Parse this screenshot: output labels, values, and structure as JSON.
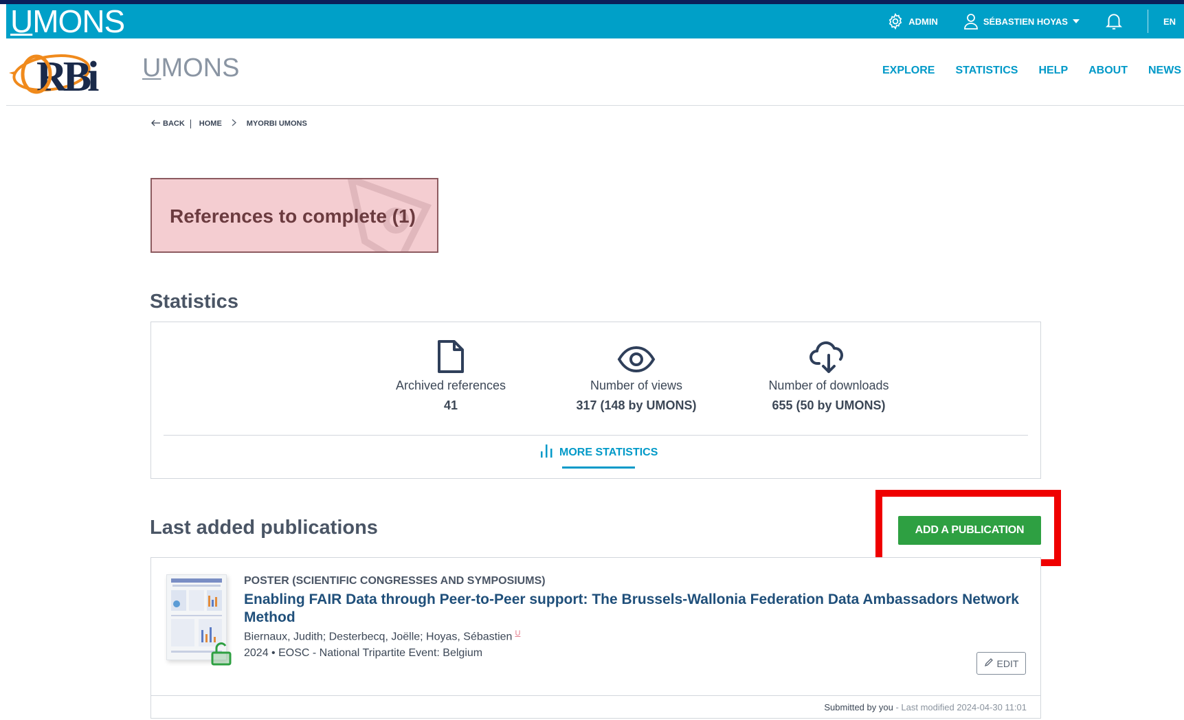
{
  "topbar": {
    "logo_text": "UMONS",
    "admin_label": "ADMIN",
    "user_label": "SÉBASTIEN HOYAS",
    "lang_label": "EN",
    "colors": {
      "bar": "#00a0c8",
      "strip": "#0b1f5a"
    }
  },
  "header": {
    "orbi_logo": "ORBi",
    "institution": "UMONS",
    "nav": [
      "EXPLORE",
      "STATISTICS",
      "HELP",
      "ABOUT",
      "NEWS"
    ]
  },
  "breadcrumb": {
    "back": "BACK",
    "home": "HOME",
    "current": "MYORBI UMONS"
  },
  "references_box": {
    "label": "References to complete (1)"
  },
  "statistics": {
    "heading": "Statistics",
    "items": [
      {
        "icon": "document-icon",
        "label": "Archived references",
        "value": "41"
      },
      {
        "icon": "eye-icon",
        "label": "Number of views",
        "value": "317 (148 by UMONS)"
      },
      {
        "icon": "download-cloud-icon",
        "label": "Number of downloads",
        "value": "655 (50 by UMONS)"
      }
    ],
    "more_label": "MORE STATISTICS"
  },
  "publications": {
    "heading": "Last added publications",
    "add_button": "ADD A PUBLICATION",
    "items": [
      {
        "type": "POSTER (SCIENTIFIC CONGRESSES AND SYMPOSIUMS)",
        "title": "Enabling FAIR Data through Peer-to-Peer support: The Brussels-Wallonia Federation Data Ambassadors Network Method",
        "authors": "Biernaux, Judith; Desterbecq, Joëlle; Hoyas, Sébastien",
        "author_mark": "U",
        "meta": "2024 • EOSC - National Tripartite Event: Belgium",
        "edit_label": "EDIT",
        "submitted_by": "Submitted by you",
        "last_modified": " - Last modified 2024-04-30 11:01"
      }
    ]
  },
  "accent_colors": {
    "link": "#0099c8",
    "add_button": "#2ea042",
    "highlight": "#ef0000",
    "ref_box": "#f4cdd1"
  }
}
